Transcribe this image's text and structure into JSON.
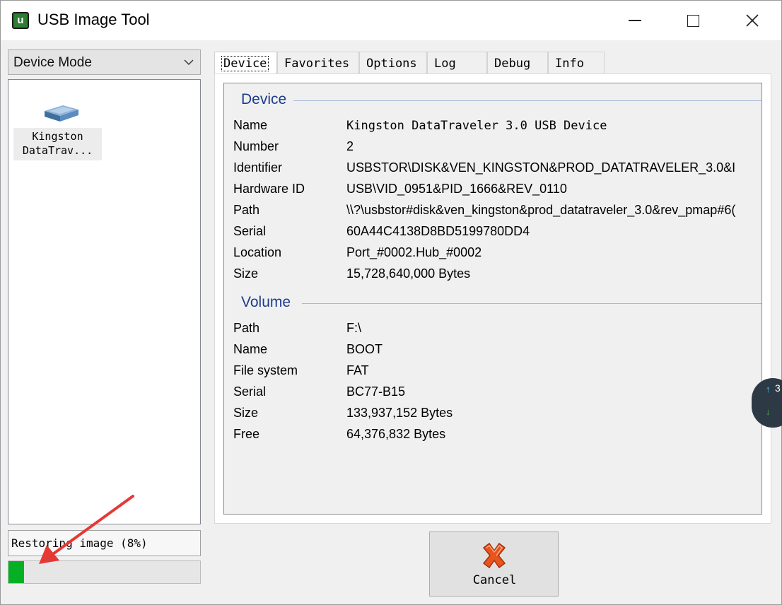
{
  "window": {
    "title": "USB Image Tool",
    "app_icon_letter": "u"
  },
  "sidebar": {
    "mode_select_value": "Device Mode",
    "devices": [
      {
        "label_line1": "Kingston",
        "label_line2": "DataTrav..."
      }
    ],
    "status_text": "Restoring image (8%)",
    "progress_percent": 8
  },
  "tabs": [
    {
      "label": "Device",
      "active": true
    },
    {
      "label": "Favorites"
    },
    {
      "label": "Options"
    },
    {
      "label": "Log"
    },
    {
      "label": "Debug"
    },
    {
      "label": "Info"
    }
  ],
  "device_group": {
    "header": "Device",
    "rows": [
      {
        "label": "Name",
        "value": "Kingston DataTraveler 3.0 USB Device"
      },
      {
        "label": "Number",
        "value": "2"
      },
      {
        "label": "Identifier",
        "value": "USBSTOR\\DISK&VEN_KINGSTON&PROD_DATATRAVELER_3.0&I"
      },
      {
        "label": "Hardware ID",
        "value": "USB\\VID_0951&PID_1666&REV_0110"
      },
      {
        "label": "Path",
        "value": "\\\\?\\usbstor#disk&ven_kingston&prod_datatraveler_3.0&rev_pmap#6("
      },
      {
        "label": "Serial",
        "value": "60A44C4138D8BD5199780DD4"
      },
      {
        "label": "Location",
        "value": "Port_#0002.Hub_#0002"
      },
      {
        "label": "Size",
        "value": "15,728,640,000 Bytes"
      }
    ]
  },
  "volume_group": {
    "header": "Volume",
    "rows": [
      {
        "label": "Path",
        "value": "F:\\"
      },
      {
        "label": "Name",
        "value": "BOOT"
      },
      {
        "label": "File system",
        "value": "FAT"
      },
      {
        "label": "Serial",
        "value": "BC77-B15"
      },
      {
        "label": "Size",
        "value": "133,937,152 Bytes"
      },
      {
        "label": "Free",
        "value": "64,376,832 Bytes"
      }
    ]
  },
  "side_widget": {
    "count": "3"
  },
  "cancel_button": {
    "label": "Cancel"
  },
  "colors": {
    "progress_fill": "#06b025",
    "group_header": "#1e3c8c",
    "cancel_icon": "#e8541c",
    "annotation_arrow": "#e53935"
  }
}
